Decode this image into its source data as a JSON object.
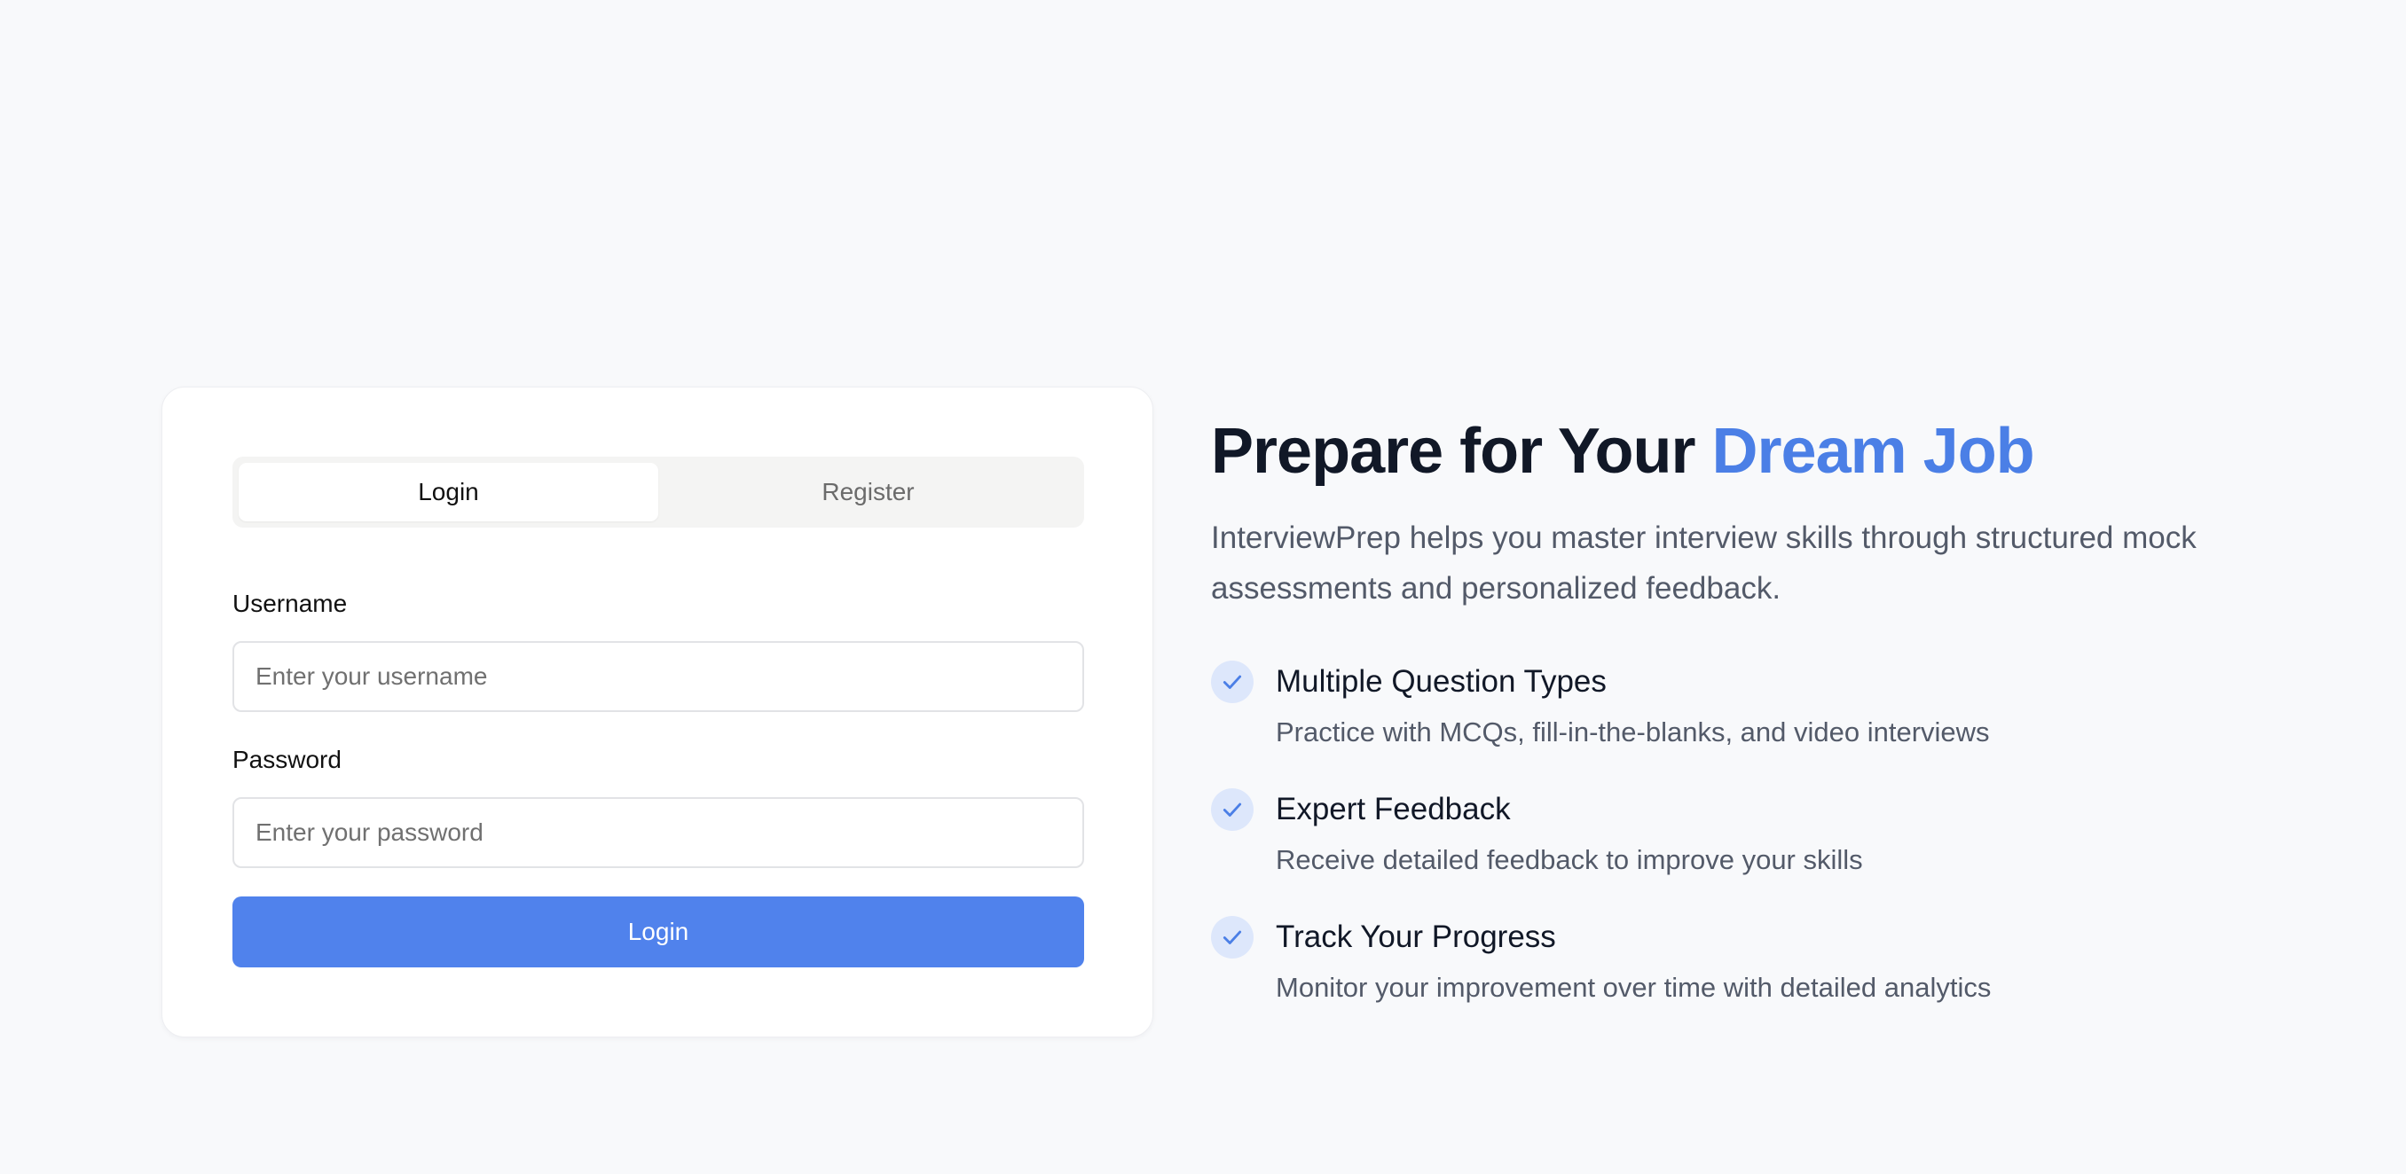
{
  "auth_card": {
    "tabs": [
      {
        "label": "Login",
        "active": true
      },
      {
        "label": "Register",
        "active": false
      }
    ],
    "username": {
      "label": "Username",
      "placeholder": "Enter your username",
      "value": ""
    },
    "password": {
      "label": "Password",
      "placeholder": "Enter your password",
      "value": ""
    },
    "submit_label": "Login"
  },
  "hero": {
    "title_prefix": "Prepare for Your ",
    "title_accent": "Dream Job",
    "description": "InterviewPrep helps you master interview skills through structured mock assessments and personalized feedback.",
    "features": [
      {
        "icon": "check-icon",
        "title": "Multiple Question Types",
        "description": "Practice with MCQs, fill-in-the-blanks, and video interviews"
      },
      {
        "icon": "check-icon",
        "title": "Expert Feedback",
        "description": "Receive detailed feedback to improve your skills"
      },
      {
        "icon": "check-icon",
        "title": "Track Your Progress",
        "description": "Monitor your improvement over time with detailed analytics"
      }
    ]
  },
  "colors": {
    "background": "#f8f9fb",
    "accent": "#4b7fe6",
    "button": "#5082ec",
    "check_bg": "#dde7fb",
    "heading": "#111827",
    "muted_text": "#535a69"
  }
}
